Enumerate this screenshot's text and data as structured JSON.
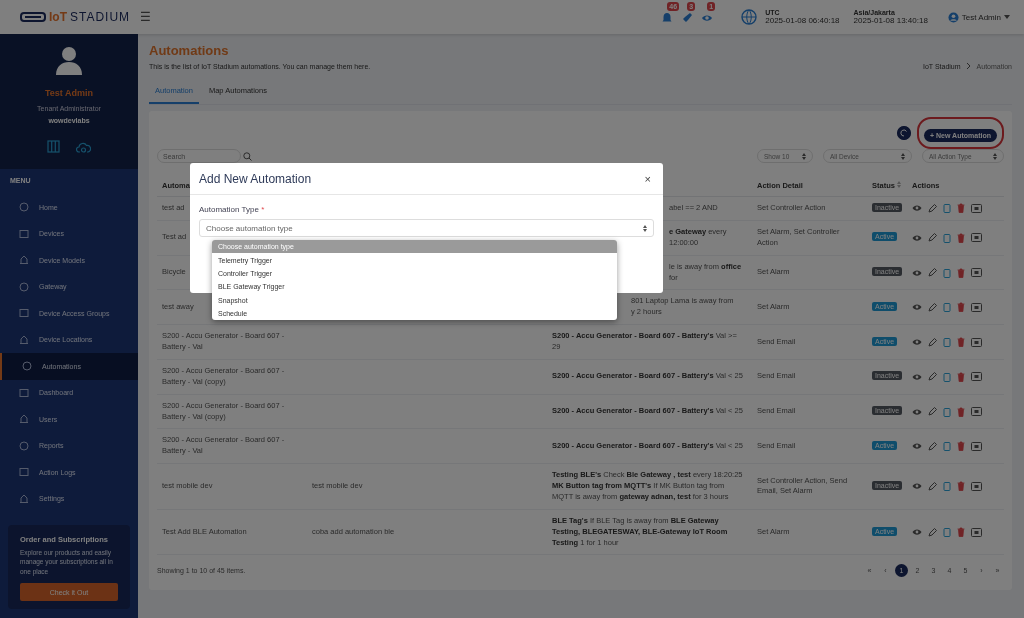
{
  "topbar": {
    "logo_prefix": "IoT",
    "logo_name": "STADIUM",
    "menu_glyph": "☰",
    "notifications": [
      {
        "count": "46"
      },
      {
        "count": "3"
      },
      {
        "count": "1"
      }
    ],
    "clocks": [
      {
        "zone": "UTC",
        "time": "2025-01-08 06:40:18"
      },
      {
        "zone": "Asia/Jakarta",
        "time": "2025-01-08 13:40:18"
      }
    ],
    "user": "Test Admin"
  },
  "sidebar": {
    "name": "Test Admin",
    "role": "Tenant Administrator",
    "org": "wowdevlabs",
    "menu_label": "MENU",
    "items": [
      {
        "label": "Home",
        "selected": false
      },
      {
        "label": "Devices",
        "selected": false
      },
      {
        "label": "Device Models",
        "selected": false
      },
      {
        "label": "Gateway",
        "selected": false
      },
      {
        "label": "Device Access Groups",
        "selected": false
      },
      {
        "label": "Device Locations",
        "selected": false
      },
      {
        "label": "Automations",
        "selected": true
      },
      {
        "label": "Dashboard",
        "selected": false
      },
      {
        "label": "Users",
        "selected": false
      },
      {
        "label": "Reports",
        "selected": false
      },
      {
        "label": "Action Logs",
        "selected": false
      },
      {
        "label": "Settings",
        "selected": false
      }
    ],
    "promo": {
      "title": "Order and Subscriptions",
      "text": "Explore our products and easily manage your subscriptions all in one place",
      "button": "Check it Out"
    }
  },
  "page": {
    "title": "Automations",
    "subtitle": "This is the list of IoT Stadium automations. You can manage them here.",
    "breadcrumb": [
      "IoT Stadium",
      "Automation"
    ],
    "tabs": [
      {
        "label": "Automation",
        "selected": true
      },
      {
        "label": "Map Automations",
        "selected": false
      }
    ]
  },
  "toolbar": {
    "new_button": "+ New Automation",
    "search_placeholder": "Search",
    "filters": [
      "Show 10",
      "All Device",
      "All Action Type"
    ]
  },
  "table": {
    "columns": [
      "Automa",
      "Action Detail",
      "Status",
      "Actions"
    ],
    "rows": [
      {
        "name": "test ad",
        "column_2": "",
        "trigger": "abel == 2 AND",
        "action": "Set Controller Action",
        "status": "Inactive",
        "active": false
      },
      {
        "name": "Test ad",
        "column_2": "",
        "trigger": "**e Gateway** every 12:00:00",
        "action": "Set Alarm, Set Controller Action",
        "status": "Active",
        "active": true
      },
      {
        "name": "Bicycle",
        "column_2": "",
        "trigger": "le is away from **office** for",
        "action": "Set Alarm",
        "status": "Inactive",
        "active": false
      },
      {
        "name": "test away",
        "column_2": "",
        "trigger": "801 Laptop Lama is away from\ny 2 hours",
        "action": "Set Alarm",
        "status": "Active",
        "active": true
      },
      {
        "name": "S200 - Accu Generator - Board 607 - Battery - Val",
        "column_2": "",
        "trigger": "**S200 - Accu Generator - Board 607 - Battery's** Val >= 29",
        "action": "Send Email",
        "status": "Active",
        "active": true
      },
      {
        "name": "S200 - Accu Generator - Board 607 - Battery - Val (copy)",
        "column_2": "",
        "trigger": "**S200 - Accu Generator - Board 607 - Battery's** Val < 25",
        "action": "Send Email",
        "status": "Inactive",
        "active": false
      },
      {
        "name": "S200 - Accu Generator - Board 607 - Battery - Val (copy)",
        "column_2": "",
        "trigger": "**S200 - Accu Generator - Board 607 - Battery's** Val < 25",
        "action": "Send Email",
        "status": "Inactive",
        "active": false
      },
      {
        "name": "S200 - Accu Generator - Board 607 - Battery - Val",
        "column_2": "",
        "trigger": "**S200 - Accu Generator - Board 607 - Battery's** Val < 25",
        "action": "Send Email",
        "status": "Active",
        "active": true
      },
      {
        "name": "test mobile dev",
        "column_2": "test mobile dev",
        "trigger": "**Testing BLE's** Check **Ble Gateway , test** every 18:20:25 **MK Button tag from MQTT's** If MK Button tag from MQTT is away from **gateway adnan, test** for 3 hours",
        "action": "Set Controller Action, Send Email, Set Alarm",
        "status": "Inactive",
        "active": false
      },
      {
        "name": "Test Add BLE Automation",
        "column_2": "coba add automation ble",
        "trigger": "**BLE Tag's** If BLE Tag is away from **BLE Gateway Testing, BLEGATESWAY, BLE-Gateway IoT Room Testing** 1 for 1 hour",
        "action": "Set Alarm",
        "status": "Active",
        "active": true
      }
    ],
    "summary": "Showing 1 to 10 of 45 items.",
    "pagination": [
      {
        "label": "«",
        "selected": false
      },
      {
        "label": "‹",
        "selected": false
      },
      {
        "label": "1",
        "selected": true
      },
      {
        "label": "2",
        "selected": false
      },
      {
        "label": "3",
        "selected": false
      },
      {
        "label": "4",
        "selected": false
      },
      {
        "label": "5",
        "selected": false
      },
      {
        "label": "›",
        "selected": false
      },
      {
        "label": "»",
        "selected": false
      }
    ]
  },
  "modal": {
    "title": "Add New Automation",
    "close": "×",
    "field_label": "Automation Type",
    "required_mark": "*",
    "placeholder": "Choose automation type",
    "options": [
      {
        "label": "Choose automation type",
        "selected": true
      },
      {
        "label": "Telemetry Trigger",
        "selected": false
      },
      {
        "label": "Controller Trigger",
        "selected": false
      },
      {
        "label": "BLE Gateway Trigger",
        "selected": false
      },
      {
        "label": "Snapshot",
        "selected": false
      },
      {
        "label": "Schedule",
        "selected": false
      }
    ]
  }
}
